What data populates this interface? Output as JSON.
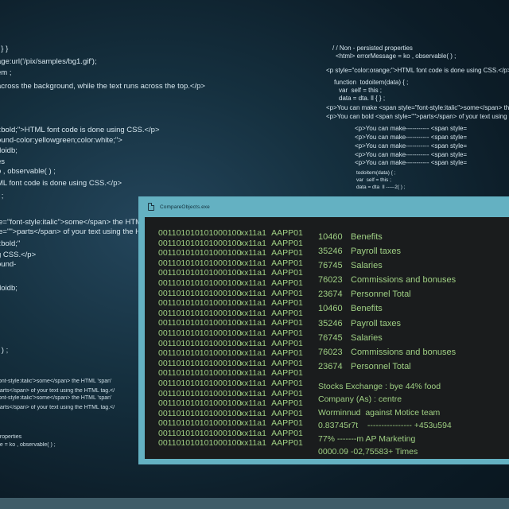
{
  "background_code_left": [
    "  } }",
    "age:url('/pix/samples/bg1.gif');",
    "em ;",
    "across the background, while the text runs across the top.</p>",
    "t:bold;\">HTML font code is done using CSS.</p>",
    "ound-color:yellowgreen;color:white;\">",
    "doidb;",
    "es",
    "o , observable( ) ;",
    "ML font code is done using CSS.</p>",
    "{ ;",
    "le=\"font-style:italic\">some</span> the HTML",
    "le=\"\">parts</span> of your text using the HTML",
    "t:bold;\"",
    "g CSS.</p>",
    "ound-",
    "doidb;",
    "( ) ;",
    "font-style:italic'>some</span> the HTML 'span'",
    "parts</span> of your text using the HTML tag.</",
    "font-style:italic'>some</span> the HTML 'span'",
    "parts</span> of your text using the HTML tag.</",
    "properties",
    "ge = ko , observable( ) ;"
  ],
  "background_code_right": [
    "/ / Non - persisted properties",
    "<html> errorMessage = ko , observable( ) ;",
    "<p style=\"color:orange;\">HTML font code is done using CSS.</p>",
    "function  todoitem(data) { ;",
    "var  self = this ;",
    "data = dta. ll { } ;",
    "<p>You can make <span style=\"font-style:italic\">some</span> the",
    "<p>You can bold <span style=\"\">parts</span> of your text using",
    "<p>You can make----------- <span style=",
    "<p>You can make----------- <span style=",
    "<p>You can make----------- <span style=",
    "<p>You can make----------- <span style=",
    "<p>You can make----------- <span style=",
    "todoitem(data) { ;",
    "var  self = this ;",
    "data = dta  ll -----2( ) ;"
  ],
  "window": {
    "title": "CompareObjects.exe",
    "binary_rows": {
      "code": "001101010101000100",
      "tag": "xx11a1",
      "id": "AAPP01",
      "count": 22
    },
    "items": [
      {
        "num": "10460",
        "label": "Benefits"
      },
      {
        "num": "35246",
        "label": "Payroll taxes"
      },
      {
        "num": "76745",
        "label": "Salaries"
      },
      {
        "num": "76023",
        "label": "Commissions and bonuses"
      },
      {
        "num": "23674",
        "label": "Personnel Total"
      },
      {
        "num": "10460",
        "label": "Benefits"
      },
      {
        "num": "35246",
        "label": "Payroll taxes"
      },
      {
        "num": "76745",
        "label": "Salaries"
      },
      {
        "num": "76023",
        "label": "Commissions and bonuses"
      },
      {
        "num": "23674",
        "label": "Personnel Total"
      }
    ],
    "notes": [
      "Stocks Exchange : bye 44% food",
      "Company (As) : centre",
      "Worminnud  against Motice team",
      "0.83745r7t    ---------------- +453u594",
      "77% -------m AP Marketing",
      "0000.09 -02,75583+ Times"
    ]
  },
  "colors": {
    "terminal_text": "#9fcf83",
    "window_frame": "#64b1c2",
    "terminal_bg": "#1a1c1d",
    "background": "#15303f"
  }
}
